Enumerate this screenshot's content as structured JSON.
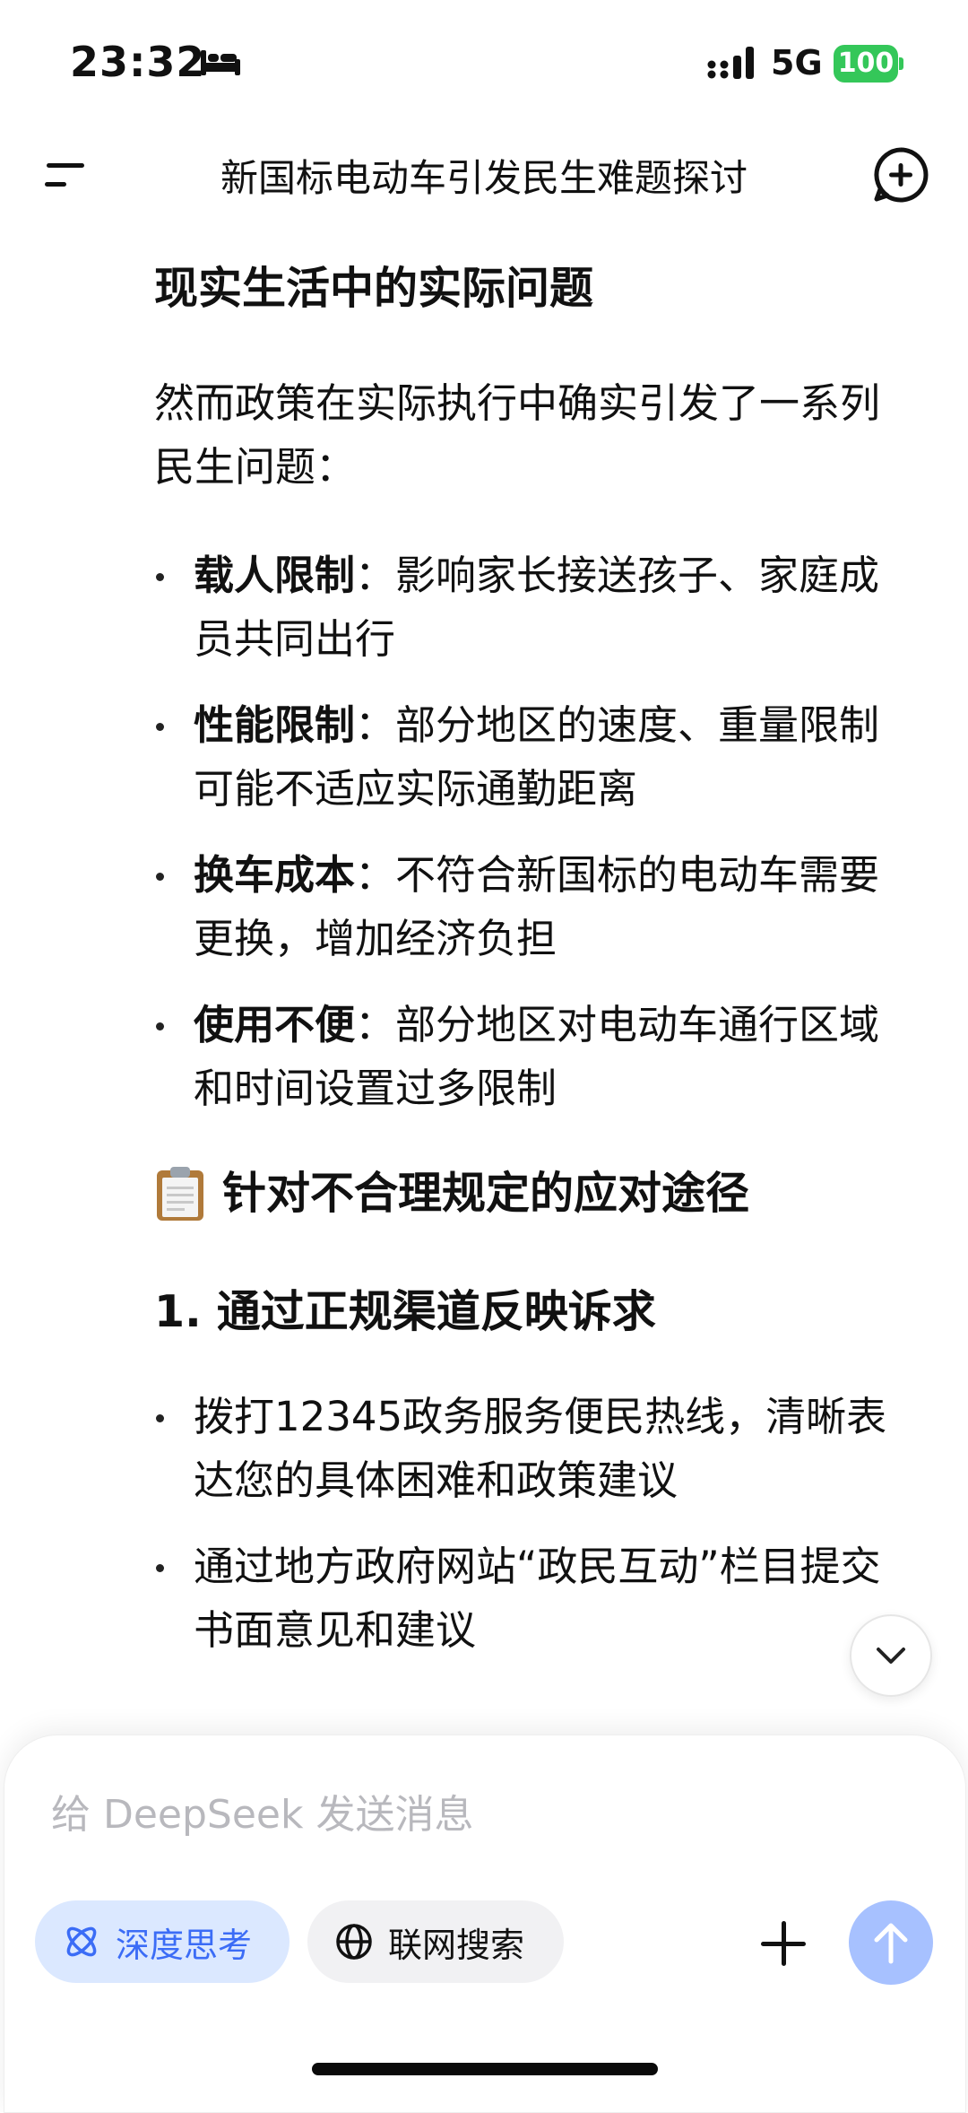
{
  "status_bar": {
    "time": "23:32",
    "network": "5G",
    "battery": "100"
  },
  "header": {
    "title": "新国标电动车引发民生难题探讨"
  },
  "content": {
    "section1_title": "现实生活中的实际问题",
    "intro": "然而政策在实际执行中确实引发了一系列民生问题：",
    "problems": [
      {
        "term": "载人限制",
        "text": "：影响家长接送孩子、家庭成员共同出行"
      },
      {
        "term": "性能限制",
        "text": "：部分地区的速度、重量限制可能不适应实际通勤距离"
      },
      {
        "term": "换车成本",
        "text": "：不符合新国标的电动车需要更换，增加经济负担"
      },
      {
        "term": "使用不便",
        "text": "：部分地区对电动车通行区域和时间设置过多限制"
      }
    ],
    "section2_title": "针对不合理规定的应对途径",
    "subsection1_title": "1. 通过正规渠道反映诉求",
    "channels": [
      "拨打12345政务服务便民热线，清晰表达您的具体困难和政策建议",
      "通过地方政府网站“政民互动”栏目提交书面意见和建议"
    ]
  },
  "composer": {
    "placeholder": "给 DeepSeek 发送消息",
    "deep_think_label": "深度思考",
    "web_search_label": "联网搜索"
  },
  "colors": {
    "accent": "#3b6cf6",
    "send_disabled": "#a7c1ff",
    "battery": "#34c759"
  }
}
